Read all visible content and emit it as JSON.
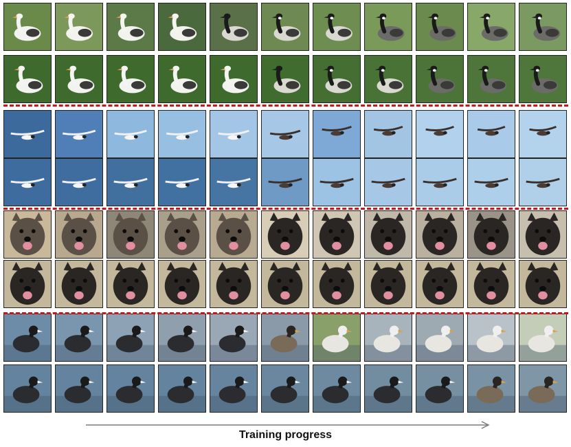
{
  "figure": {
    "caption": "Training progress"
  },
  "groups": [
    {
      "subject": "goose",
      "rows": [
        {
          "tiles": 11,
          "bg": [
            "#6a8a4a",
            "#7c985a",
            "#5b7a48",
            "#4a6a3e",
            "#5a7048",
            "#6e8a52",
            "#6d8e50",
            "#7a9a5a",
            "#6a8a4e",
            "#88a86a",
            "#7a9a62"
          ]
        },
        {
          "tiles": 11,
          "bg": [
            "#3f6a2e",
            "#3f6a2e",
            "#3f6a2e",
            "#3f6a2e",
            "#3f6a2e",
            "#416c30",
            "#456e32",
            "#497236",
            "#4c7438",
            "#4e763a",
            "#4f773b"
          ]
        }
      ]
    },
    {
      "subject": "seabird",
      "rows": [
        {
          "tiles": 11,
          "bg": [
            "#3c6a9c",
            "#4f7fb6",
            "#8fb8de",
            "#97bfe2",
            "#a3c6e6",
            "#a6c8e6",
            "#7ea9d6",
            "#a3c5e4",
            "#b2d1ec",
            "#a9cbe9",
            "#b3d2ec"
          ]
        },
        {
          "tiles": 11,
          "bg": [
            "#3e6c9e",
            "#3f6d9f",
            "#41709f",
            "#4171a0",
            "#4675a4",
            "#6f9ac6",
            "#9cc2e4",
            "#a6c8e6",
            "#abcce8",
            "#aecfea",
            "#b0d0ea"
          ]
        }
      ]
    },
    {
      "subject": "terrier",
      "rows": [
        {
          "tiles": 11,
          "bg": [
            "#c9b89a",
            "#b8a98e",
            "#8e8676",
            "#a9a08c",
            "#b7aa90",
            "#d8ceb8",
            "#cfc6b3",
            "#c0b8a8",
            "#b9b0a0",
            "#9a9488",
            "#c7bfae"
          ]
        },
        {
          "tiles": 11,
          "bg": [
            "#c4b89c",
            "#c4b89c",
            "#c4b89c",
            "#c4b89c",
            "#c4b89c",
            "#c4b89c",
            "#c4b89c",
            "#c4b89c",
            "#c4b89c",
            "#c4b89c",
            "#c4b89c"
          ]
        }
      ]
    },
    {
      "subject": "coot-to-gull",
      "rows": [
        {
          "tiles": 11,
          "bg": [
            "#6d8ca8",
            "#7a95ae",
            "#8ea2b5",
            "#8f9fae",
            "#9aa8b6",
            "#8a9aa8",
            "#8aa06a",
            "#a8b4bc",
            "#9eaab2",
            "#b8c2c8",
            "#c3cdb8"
          ]
        },
        {
          "tiles": 11,
          "bg": [
            "#64839e",
            "#64839e",
            "#64839e",
            "#64839e",
            "#66849e",
            "#6a879f",
            "#6e8aa0",
            "#728ca0",
            "#7690a2",
            "#7a93a4",
            "#7e96a6"
          ]
        }
      ]
    }
  ]
}
